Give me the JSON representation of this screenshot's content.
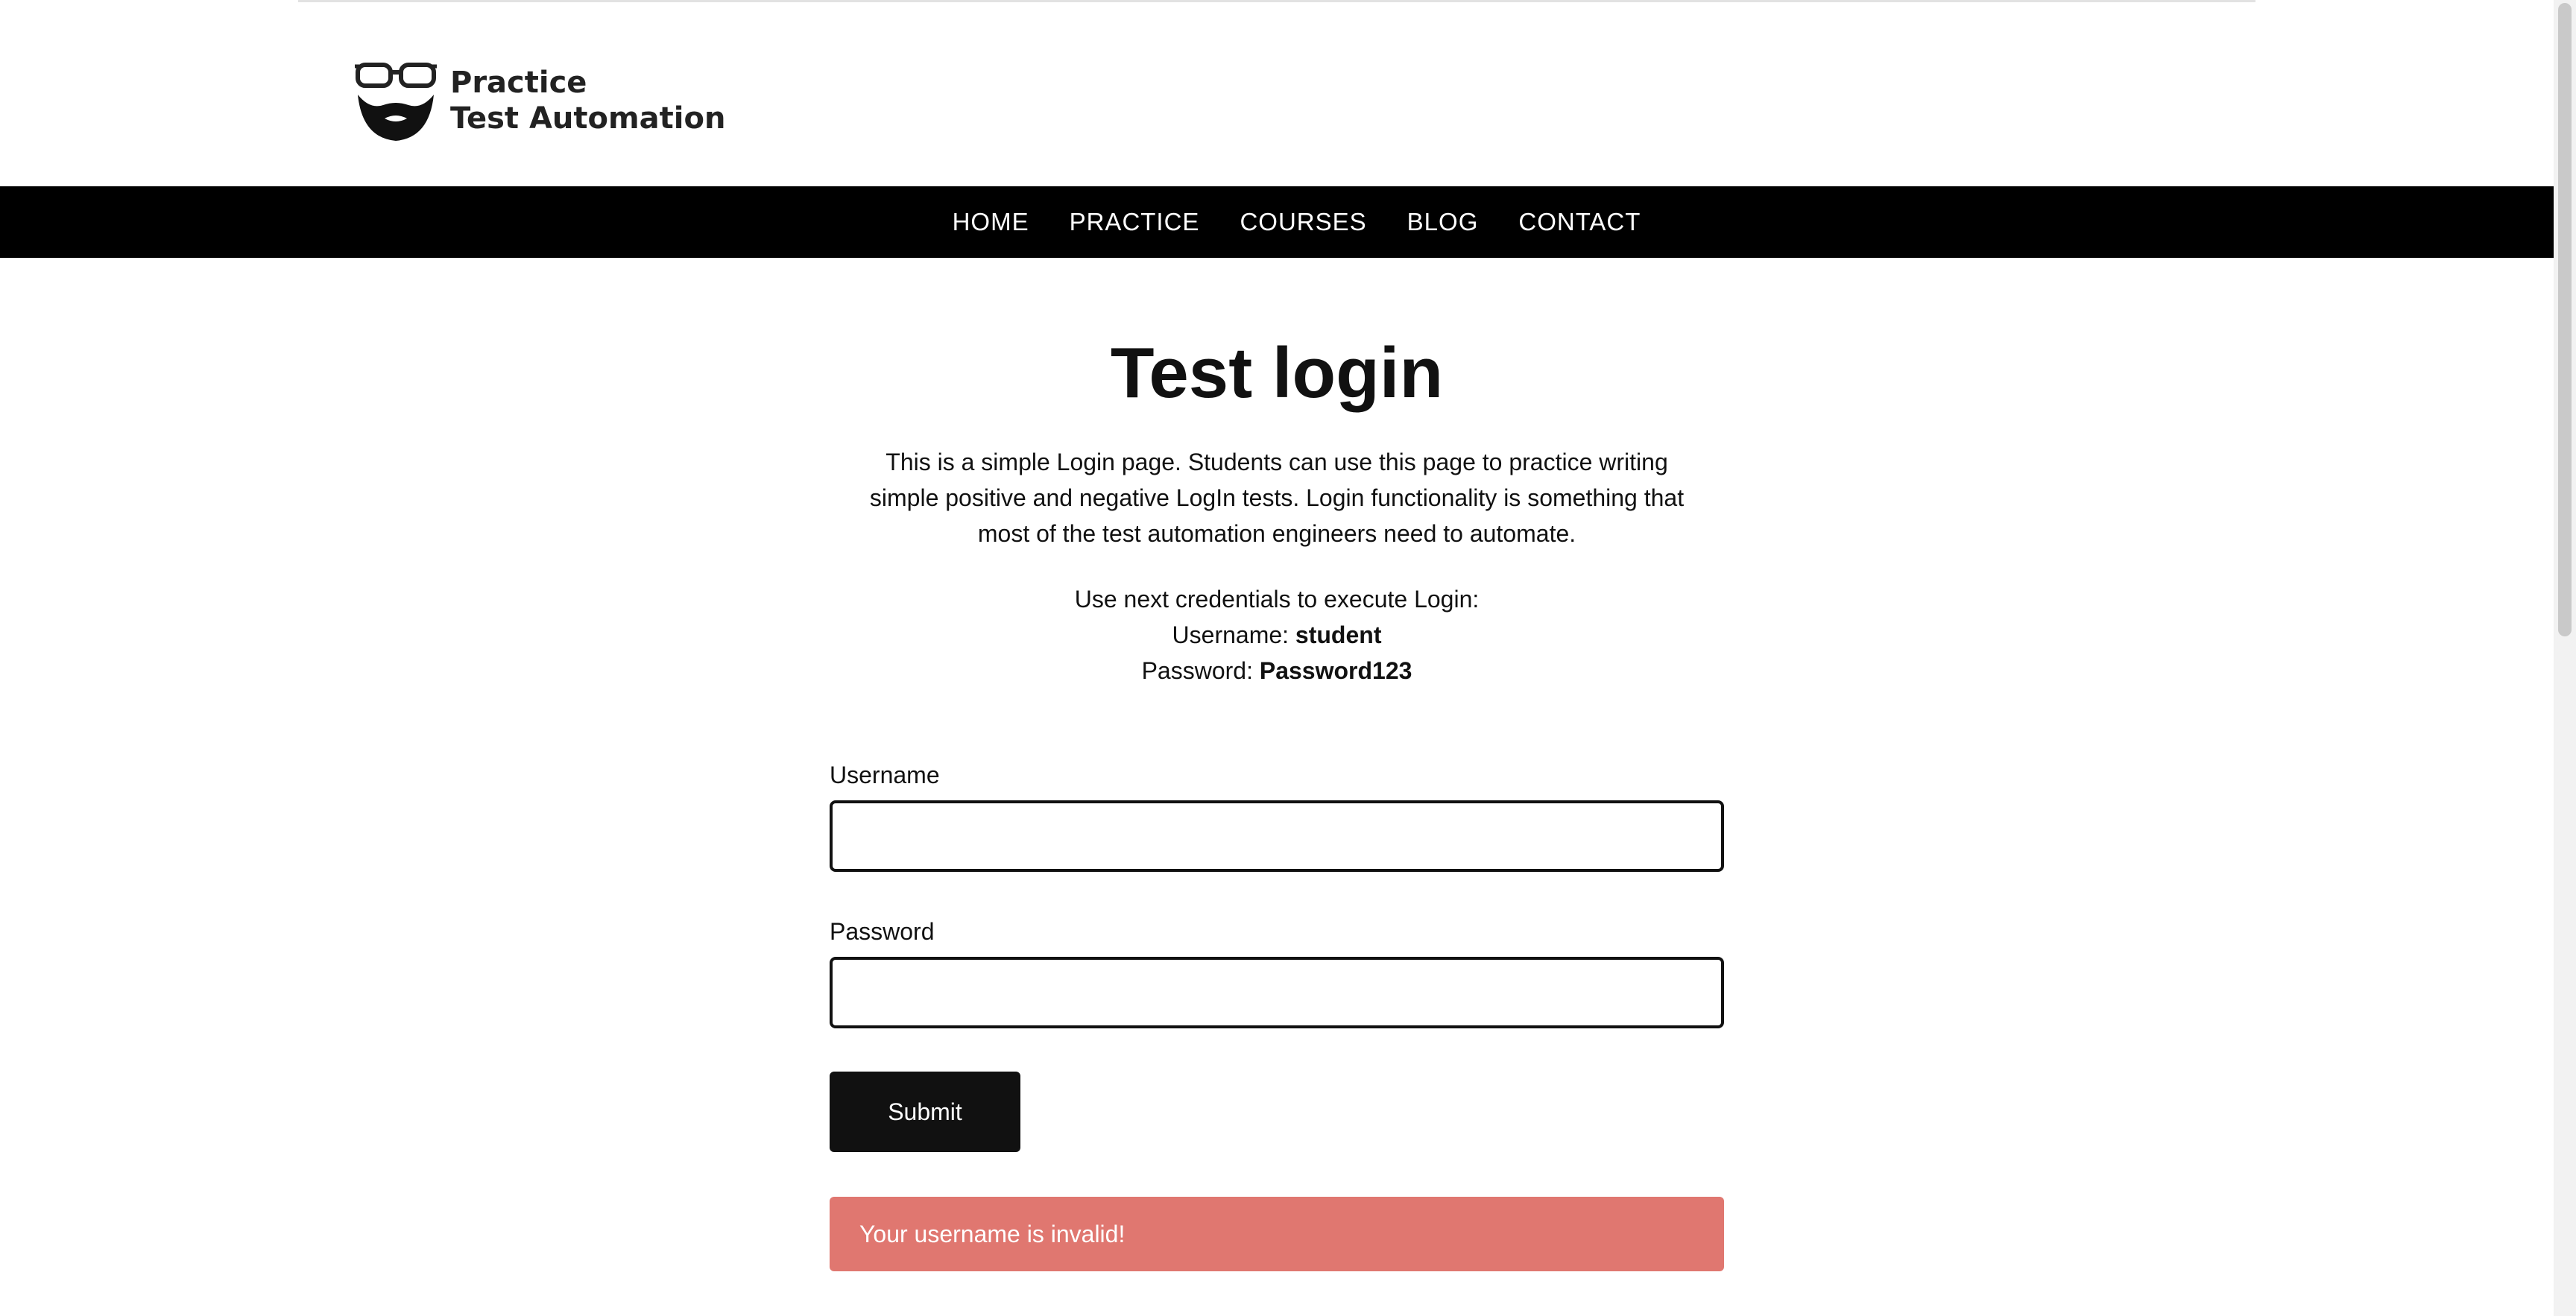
{
  "header": {
    "logo_line1": "Practice",
    "logo_line2": "Test Automation"
  },
  "nav": {
    "items": [
      "HOME",
      "PRACTICE",
      "COURSES",
      "BLOG",
      "CONTACT"
    ]
  },
  "main": {
    "title": "Test login",
    "intro": "This is a simple Login page. Students can use this page to practice writing simple positive and negative LogIn tests. Login functionality is something that most of the test automation engineers need to automate.",
    "creds_intro": "Use next credentials to execute Login:",
    "username_label": "Username:",
    "username_value": "student",
    "password_label": "Password:",
    "password_value": "Password123"
  },
  "form": {
    "username_label": "Username",
    "username_value": "",
    "password_label": "Password",
    "password_value": "",
    "submit_label": "Submit"
  },
  "error": {
    "message": "Your username is invalid!"
  },
  "colors": {
    "nav_bg": "#000000",
    "error_bg": "#e07770",
    "button_bg": "#111111"
  }
}
